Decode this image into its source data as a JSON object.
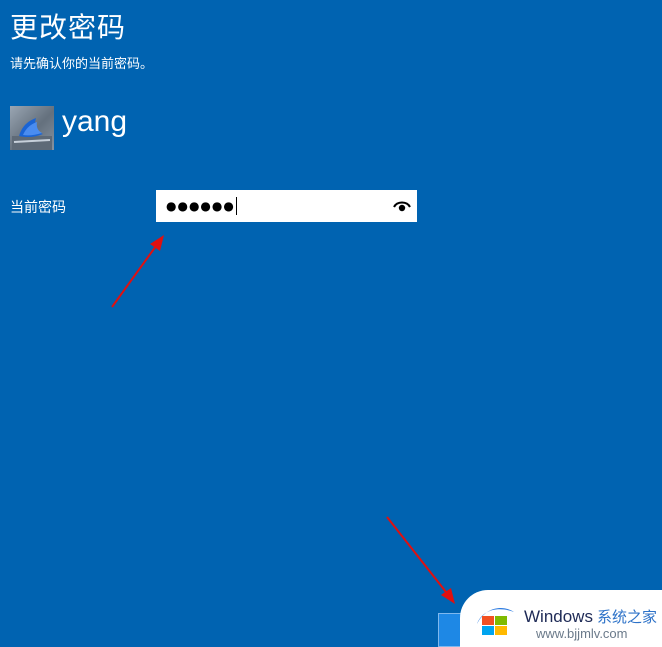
{
  "page": {
    "title": "更改密码",
    "subtitle": "请先确认你的当前密码。"
  },
  "user": {
    "name": "yang",
    "avatar_icon": "account-picture-icon"
  },
  "form": {
    "current_password_label": "当前密码",
    "current_password_masked": "●●●●●●",
    "reveal_icon": "eye-icon"
  },
  "watermark": {
    "title": "Windows",
    "title_cn": "系统之家",
    "url": "www.bjjmlv.com"
  },
  "colors": {
    "background": "#0063b1",
    "text": "#ffffff",
    "annotation_arrow": "#e01010"
  }
}
